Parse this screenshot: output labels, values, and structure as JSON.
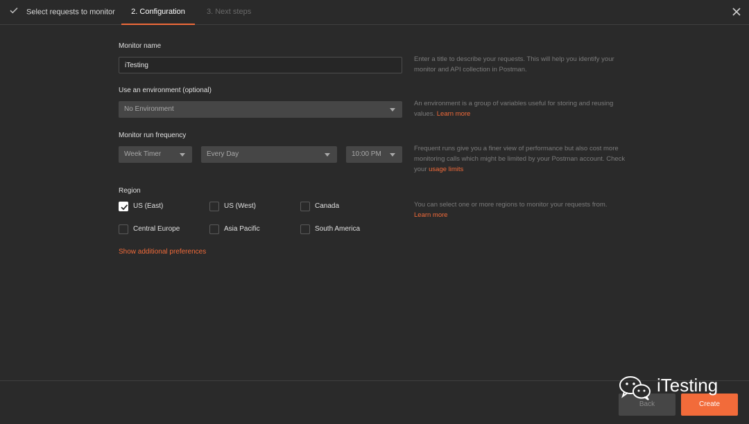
{
  "header": {
    "steps": [
      {
        "label": "Select requests to monitor",
        "state": "done"
      },
      {
        "label": "2. Configuration",
        "state": "active"
      },
      {
        "label": "3. Next steps",
        "state": "pending"
      }
    ],
    "accent_color": "#f26b3a"
  },
  "form": {
    "monitor_name": {
      "label": "Monitor name",
      "value": "iTesting",
      "help": "Enter a title to describe your requests. This will help you identify your monitor and API collection in Postman."
    },
    "environment": {
      "label": "Use an environment (optional)",
      "selected": "No Environment",
      "help": "An environment is a group of variables useful for storing and reusing values.",
      "help_link": "Learn more"
    },
    "frequency": {
      "label": "Monitor run frequency",
      "timer": "Week Timer",
      "day": "Every Day",
      "time": "10:00 PM",
      "help": "Frequent runs give you a finer view of performance but also cost more monitoring calls which might be limited by your Postman account. Check your",
      "help_link": "usage limits"
    },
    "region": {
      "label": "Region",
      "options": [
        {
          "label": "US (East)",
          "checked": true
        },
        {
          "label": "US (West)",
          "checked": false
        },
        {
          "label": "Canada",
          "checked": false
        },
        {
          "label": "Central Europe",
          "checked": false
        },
        {
          "label": "Asia Pacific",
          "checked": false
        },
        {
          "label": "South America",
          "checked": false
        }
      ],
      "help": "You can select one or more regions to monitor your requests from.",
      "help_link": "Learn more"
    },
    "show_additional": "Show additional preferences"
  },
  "footer": {
    "back_label": "Back",
    "create_label": "Create"
  },
  "watermark": {
    "text": "iTesting",
    "icon": "wechat-icon"
  }
}
